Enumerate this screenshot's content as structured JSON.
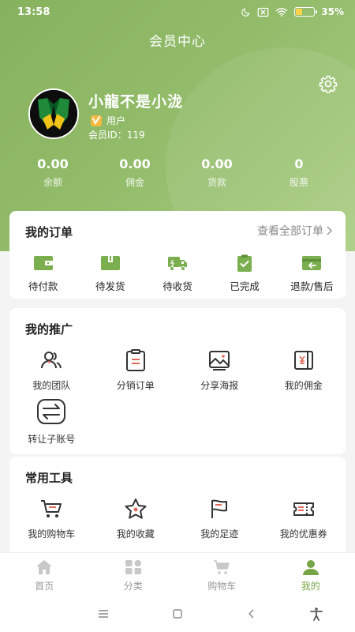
{
  "status_bar": {
    "time": "13:58",
    "battery": "35",
    "battery_level": 0.35
  },
  "header": {
    "title": "会员中心"
  },
  "profile": {
    "name": "小龍不是小泷",
    "role": "用户",
    "member_id_label": "会员ID：",
    "member_id": "119"
  },
  "stats": [
    {
      "value": "0.00",
      "label": "余额"
    },
    {
      "value": "0.00",
      "label": "佣金"
    },
    {
      "value": "0.00",
      "label": "货款"
    },
    {
      "value": "0",
      "label": "股票"
    }
  ],
  "orders": {
    "title": "我的订单",
    "view_all": "查看全部订单",
    "items": [
      {
        "label": "待付款",
        "icon": "wallet-icon"
      },
      {
        "label": "待发货",
        "icon": "package-icon"
      },
      {
        "label": "待收货",
        "icon": "truck-icon"
      },
      {
        "label": "已完成",
        "icon": "clipboard-check-icon"
      },
      {
        "label": "退款/售后",
        "icon": "return-icon"
      }
    ]
  },
  "promotion": {
    "title": "我的推广",
    "items": [
      {
        "label": "我的团队",
        "icon": "team-icon"
      },
      {
        "label": "分销订单",
        "icon": "order-list-icon"
      },
      {
        "label": "分享海报",
        "icon": "poster-icon"
      },
      {
        "label": "我的佣金",
        "icon": "commission-icon"
      },
      {
        "label": "转让子账号",
        "icon": "transfer-icon"
      }
    ]
  },
  "tools": {
    "title": "常用工具",
    "items": [
      {
        "label": "我的购物车",
        "icon": "cart-icon"
      },
      {
        "label": "我的收藏",
        "icon": "star-icon"
      },
      {
        "label": "我的足迹",
        "icon": "flag-icon"
      },
      {
        "label": "我的优惠券",
        "icon": "coupon-icon"
      }
    ]
  },
  "tabbar": {
    "items": [
      {
        "label": "首页",
        "icon": "home-icon",
        "active": false
      },
      {
        "label": "分类",
        "icon": "category-icon",
        "active": false
      },
      {
        "label": "购物车",
        "icon": "cart-icon",
        "active": false
      },
      {
        "label": "我的",
        "icon": "user-icon",
        "active": true
      }
    ]
  },
  "colors": {
    "accent": "#76a548",
    "hero": "#8fb865",
    "icon_green": "#7bae4f",
    "icon_red": "#e26a5a"
  }
}
